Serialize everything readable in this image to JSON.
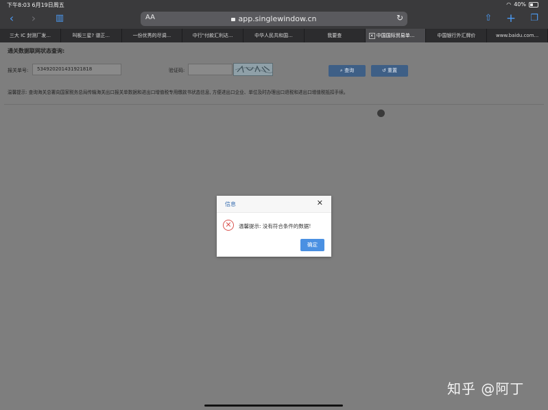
{
  "status_bar": {
    "time_date": "下午8:03   6月19日周五",
    "battery": "40%",
    "battery_level": 0.4
  },
  "browser": {
    "url": "app.singlewindow.cn",
    "text_size_label": "AA",
    "tabs": [
      {
        "label": "三大 IC 封测厂发..."
      },
      {
        "label": "叫板三星? 谱正..."
      },
      {
        "label": "一份优秀的尽调..."
      },
      {
        "label": "中行\"付款汇利达..."
      },
      {
        "label": "中华人民共和国..."
      },
      {
        "label": "我要查"
      },
      {
        "label": "中国国际贸易单...",
        "active": true
      },
      {
        "label": "中国银行外汇牌价"
      },
      {
        "label": "www.baidu.com..."
      }
    ],
    "icons": [
      "back-icon",
      "forward-icon",
      "bookmarks-icon",
      "lock-icon",
      "reload-icon",
      "share-icon",
      "add-tab-icon",
      "tabs-icon"
    ]
  },
  "page": {
    "title": "通关数据联网状态查询:",
    "declaration_label": "报关单号:",
    "declaration_value": "534920201431921818",
    "captcha_label": "验证码:",
    "captcha_value": "",
    "search_button": "查询",
    "reset_button": "重置",
    "hint": "温馨提示: 查询海关总署向国家税务总局传输海关出口报关单数据和进出口增值税专用缴款书状态信息, 方便进出口企业、单位及时办理出口退税和进出口增值税抵扣手续。"
  },
  "dialog": {
    "title": "信息",
    "message": "温馨提示: 没有符合条件的数据!",
    "ok_button": "确定"
  },
  "watermark": "知乎 @阿丁"
}
